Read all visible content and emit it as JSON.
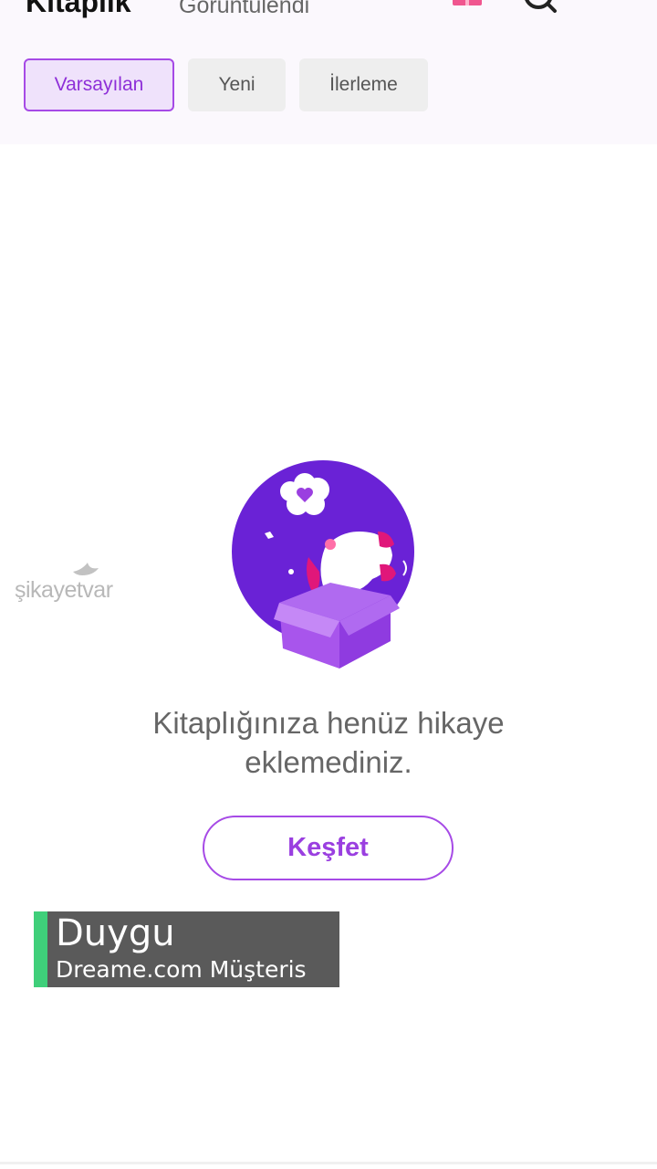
{
  "header": {
    "tabs": [
      {
        "label": "Kitaplık",
        "active": true
      },
      {
        "label": "Görüntülendi",
        "active": false
      }
    ],
    "icons": [
      "gift-icon",
      "search-icon"
    ]
  },
  "filters": {
    "chips": [
      {
        "label": "Varsayılan",
        "selected": true
      },
      {
        "label": "Yeni",
        "selected": false
      },
      {
        "label": "İlerleme",
        "selected": false
      }
    ]
  },
  "empty_state": {
    "illustration": "unicorn-in-box-illustration",
    "message": "Kitaplığınıza henüz hikaye eklemediniz.",
    "button_label": "Keşfet"
  },
  "watermark": {
    "text": "şikayetvar"
  },
  "caption": {
    "name": "Duygu",
    "subtitle": "Dreame.com Müşteris"
  },
  "colors": {
    "accent": "#a64ae6",
    "accent_text": "#9a3fe0",
    "chip_selected_bg": "#efe2fb",
    "illustration_circle": "#6a22d6",
    "caption_bg": "#5a5a5a",
    "caption_bar": "#3fcf7a"
  }
}
